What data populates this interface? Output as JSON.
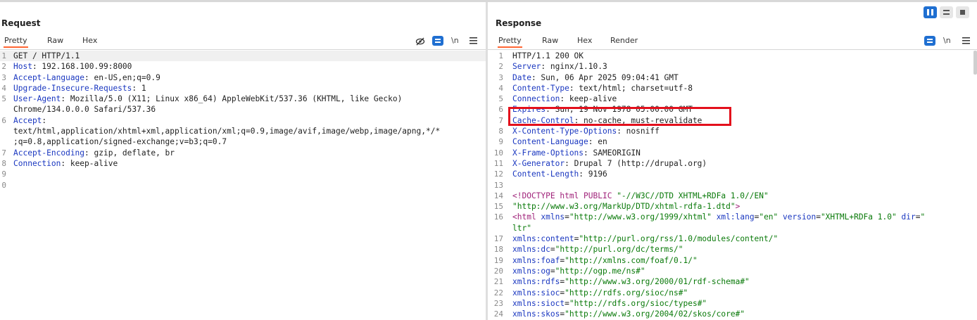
{
  "request": {
    "title": "Request",
    "tabs": [
      "Pretty",
      "Raw",
      "Hex"
    ],
    "tools": {
      "hide_icon": "eye-off-icon",
      "wrap_icon": "wrap-lines-icon",
      "newline_label": "\\n",
      "menu_icon": "hamburger-menu-icon"
    },
    "lines": [
      {
        "n": "1",
        "text": "GET / HTTP/1.1"
      },
      {
        "n": "2",
        "key": "Host",
        "val": ": 192.168.100.99:8000"
      },
      {
        "n": "3",
        "key": "Accept-Language",
        "val": ": en-US,en;q=0.9"
      },
      {
        "n": "4",
        "key": "Upgrade-Insecure-Requests",
        "val": ": 1"
      },
      {
        "n": "5",
        "key": "User-Agent",
        "val": ": Mozilla/5.0 (X11; Linux x86_64) AppleWebKit/537.36 (KHTML, like Gecko)"
      },
      {
        "n": "",
        "text": "Chrome/134.0.0.0 Safari/537.36"
      },
      {
        "n": "6",
        "key": "Accept",
        "val": ":"
      },
      {
        "n": "",
        "text": "text/html,application/xhtml+xml,application/xml;q=0.9,image/avif,image/webp,image/apng,*/*"
      },
      {
        "n": "",
        "text": ";q=0.8,application/signed-exchange;v=b3;q=0.7"
      },
      {
        "n": "7",
        "key": "Accept-Encoding",
        "val": ": gzip, deflate, br"
      },
      {
        "n": "8",
        "key": "Connection",
        "val": ": keep-alive"
      },
      {
        "n": "9",
        "text": ""
      },
      {
        "n": "0",
        "text": ""
      }
    ]
  },
  "response": {
    "title": "Response",
    "tabs": [
      "Pretty",
      "Raw",
      "Hex",
      "Render"
    ],
    "tools": {
      "wrap_icon": "wrap-lines-icon",
      "newline_label": "\\n",
      "menu_icon": "hamburger-menu-icon"
    },
    "lines": [
      {
        "n": "1",
        "text": "HTTP/1.1 200 OK"
      },
      {
        "n": "2",
        "key": "Server",
        "val": ": nginx/1.10.3"
      },
      {
        "n": "3",
        "key": "Date",
        "val": ": Sun, 06 Apr 2025 09:04:41 GMT"
      },
      {
        "n": "4",
        "key": "Content-Type",
        "val": ": text/html; charset=utf-8"
      },
      {
        "n": "5",
        "key": "Connection",
        "val": ": keep-alive"
      },
      {
        "n": "6",
        "key": "Expires",
        "val": ": Sun, 19 Nov 1978 05:00:00 GMT"
      },
      {
        "n": "7",
        "key": "Cache-Control",
        "val": ": no-cache, must-revalidate"
      },
      {
        "n": "8",
        "key": "X-Content-Type-Options",
        "val": ": nosniff"
      },
      {
        "n": "9",
        "key": "Content-Language",
        "val": ": en"
      },
      {
        "n": "10",
        "key": "X-Frame-Options",
        "val": ": SAMEORIGIN"
      },
      {
        "n": "11",
        "key": "X-Generator",
        "val": ": Drupal 7 (http://drupal.org)"
      },
      {
        "n": "12",
        "key": "Content-Length",
        "val": ": 9196"
      },
      {
        "n": "13",
        "text": ""
      },
      {
        "n": "14",
        "html": [
          [
            "tag",
            "<!DOCTYPE html PUBLIC "
          ],
          [
            "s",
            "\"-//W3C//DTD XHTML+RDFa 1.0//EN\""
          ]
        ]
      },
      {
        "n": "15",
        "html": [
          [
            "s",
            "\"http://www.w3.org/MarkUp/DTD/xhtml-rdfa-1.dtd\""
          ],
          [
            "tag",
            ">"
          ]
        ]
      },
      {
        "n": "16",
        "html": [
          [
            "tag",
            "<html "
          ],
          [
            "attr",
            "xmlns"
          ],
          [
            "txt",
            "="
          ],
          [
            "s",
            "\"http://www.w3.org/1999/xhtml\""
          ],
          [
            "txt",
            " "
          ],
          [
            "attr",
            "xml:lang"
          ],
          [
            "txt",
            "="
          ],
          [
            "s",
            "\"en\""
          ],
          [
            "txt",
            " "
          ],
          [
            "attr",
            "version"
          ],
          [
            "txt",
            "="
          ],
          [
            "s",
            "\"XHTML+RDFa 1.0\""
          ],
          [
            "txt",
            " "
          ],
          [
            "attr",
            "dir"
          ],
          [
            "txt",
            "="
          ],
          [
            "s",
            "\""
          ]
        ]
      },
      {
        "n": "",
        "html": [
          [
            "s",
            "ltr\""
          ]
        ]
      },
      {
        "n": "17",
        "html": [
          [
            "attr",
            "xmlns:content"
          ],
          [
            "txt",
            "="
          ],
          [
            "s",
            "\"http://purl.org/rss/1.0/modules/content/\""
          ]
        ]
      },
      {
        "n": "18",
        "html": [
          [
            "attr",
            "xmlns:dc"
          ],
          [
            "txt",
            "="
          ],
          [
            "s",
            "\"http://purl.org/dc/terms/\""
          ]
        ]
      },
      {
        "n": "19",
        "html": [
          [
            "attr",
            "xmlns:foaf"
          ],
          [
            "txt",
            "="
          ],
          [
            "s",
            "\"http://xmlns.com/foaf/0.1/\""
          ]
        ]
      },
      {
        "n": "20",
        "html": [
          [
            "attr",
            "xmlns:og"
          ],
          [
            "txt",
            "="
          ],
          [
            "s",
            "\"http://ogp.me/ns#\""
          ]
        ]
      },
      {
        "n": "21",
        "html": [
          [
            "attr",
            "xmlns:rdfs"
          ],
          [
            "txt",
            "="
          ],
          [
            "s",
            "\"http://www.w3.org/2000/01/rdf-schema#\""
          ]
        ]
      },
      {
        "n": "22",
        "html": [
          [
            "attr",
            "xmlns:sioc"
          ],
          [
            "txt",
            "="
          ],
          [
            "s",
            "\"http://rdfs.org/sioc/ns#\""
          ]
        ]
      },
      {
        "n": "23",
        "html": [
          [
            "attr",
            "xmlns:sioct"
          ],
          [
            "txt",
            "="
          ],
          [
            "s",
            "\"http://rdfs.org/sioc/types#\""
          ]
        ]
      },
      {
        "n": "24",
        "html": [
          [
            "attr",
            "xmlns:skos"
          ],
          [
            "txt",
            "="
          ],
          [
            "s",
            "\"http://www.w3.org/2004/02/skos/core#\""
          ]
        ]
      }
    ]
  },
  "layout_controls": {
    "icons": [
      "split-horizontal-icon",
      "split-vertical-icon",
      "single-pane-icon"
    ]
  },
  "colors": {
    "accent": "#ff6633",
    "highlight_box": "#e3101c",
    "button_blue": "#1f6fd1"
  }
}
